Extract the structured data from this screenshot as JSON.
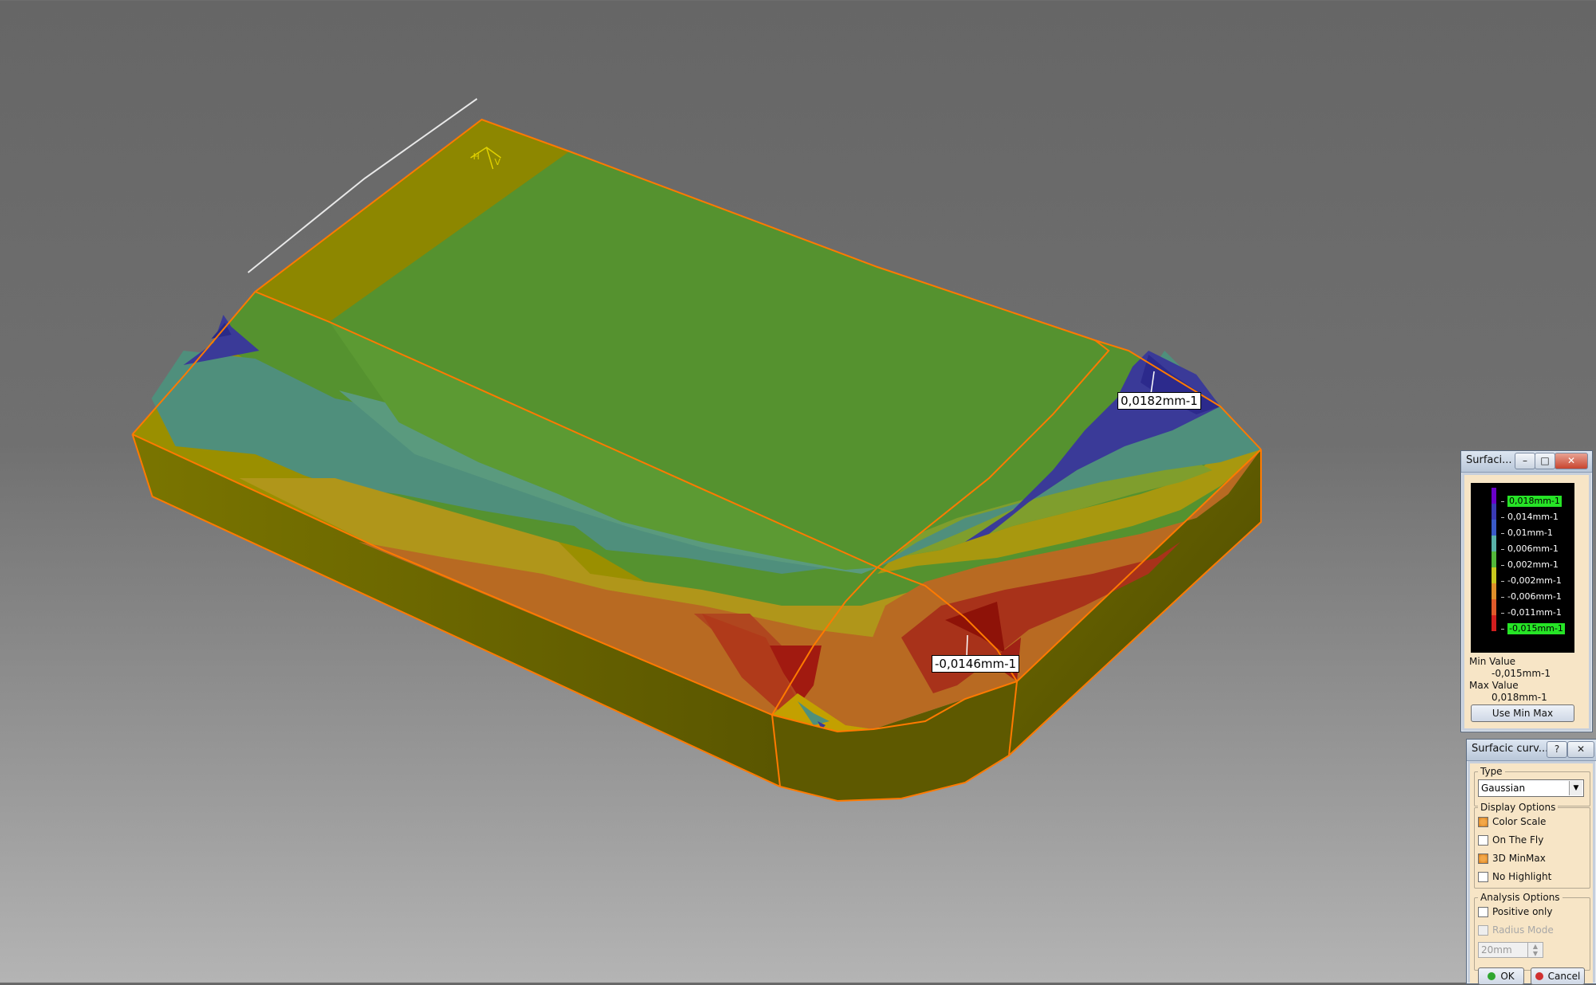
{
  "viewport": {
    "callout_max": "0,0182mm-1",
    "callout_min": "-0,0146mm-1"
  },
  "scale_window": {
    "title": "Surfaci...",
    "min_label": "Min Value",
    "min_value": "-0,015mm-1",
    "max_label": "Max Value",
    "max_value": "0,018mm-1",
    "use_min_max_label": "Use Min Max",
    "scale": [
      {
        "label": "0,018mm-1",
        "color": "#6a00c8",
        "highlight": true
      },
      {
        "label": "0,014mm-1",
        "color": "#3a3ab4",
        "highlight": false
      },
      {
        "label": "0,01mm-1",
        "color": "#3a5ac8",
        "highlight": false
      },
      {
        "label": "0,006mm-1",
        "color": "#59b2a8",
        "highlight": false
      },
      {
        "label": "0,002mm-1",
        "color": "#52b83a",
        "highlight": false
      },
      {
        "label": "-0,002mm-1",
        "color": "#c8c81e",
        "highlight": false
      },
      {
        "label": "-0,006mm-1",
        "color": "#e0902a",
        "highlight": false
      },
      {
        "label": "-0,011mm-1",
        "color": "#e05a2a",
        "highlight": false
      },
      {
        "label": "-0,015mm-1",
        "color": "#d21e1e",
        "highlight": true
      }
    ]
  },
  "dialog": {
    "title": "Surfacic curv...",
    "help": "?",
    "close": "✕",
    "type_group": "Type",
    "type_value": "Gaussian",
    "display_group": "Display Options",
    "color_scale": "Color Scale",
    "on_the_fly": "On The Fly",
    "minmax_3d": "3D MinMax",
    "no_highlight": "No Highlight",
    "analysis_group": "Analysis Options",
    "positive_only": "Positive only",
    "radius_mode": "Radius Mode",
    "radius_value": "20mm",
    "ok": "OK",
    "cancel": "Cancel"
  },
  "colors": {
    "edge": "#ff7a00",
    "green": "#55922f",
    "teal": "#4f8f7c",
    "olive": "#8d8700",
    "side": "#6a6400",
    "blue": "#3a3a98",
    "red": "#a11a10",
    "orange": "#b86a22"
  }
}
